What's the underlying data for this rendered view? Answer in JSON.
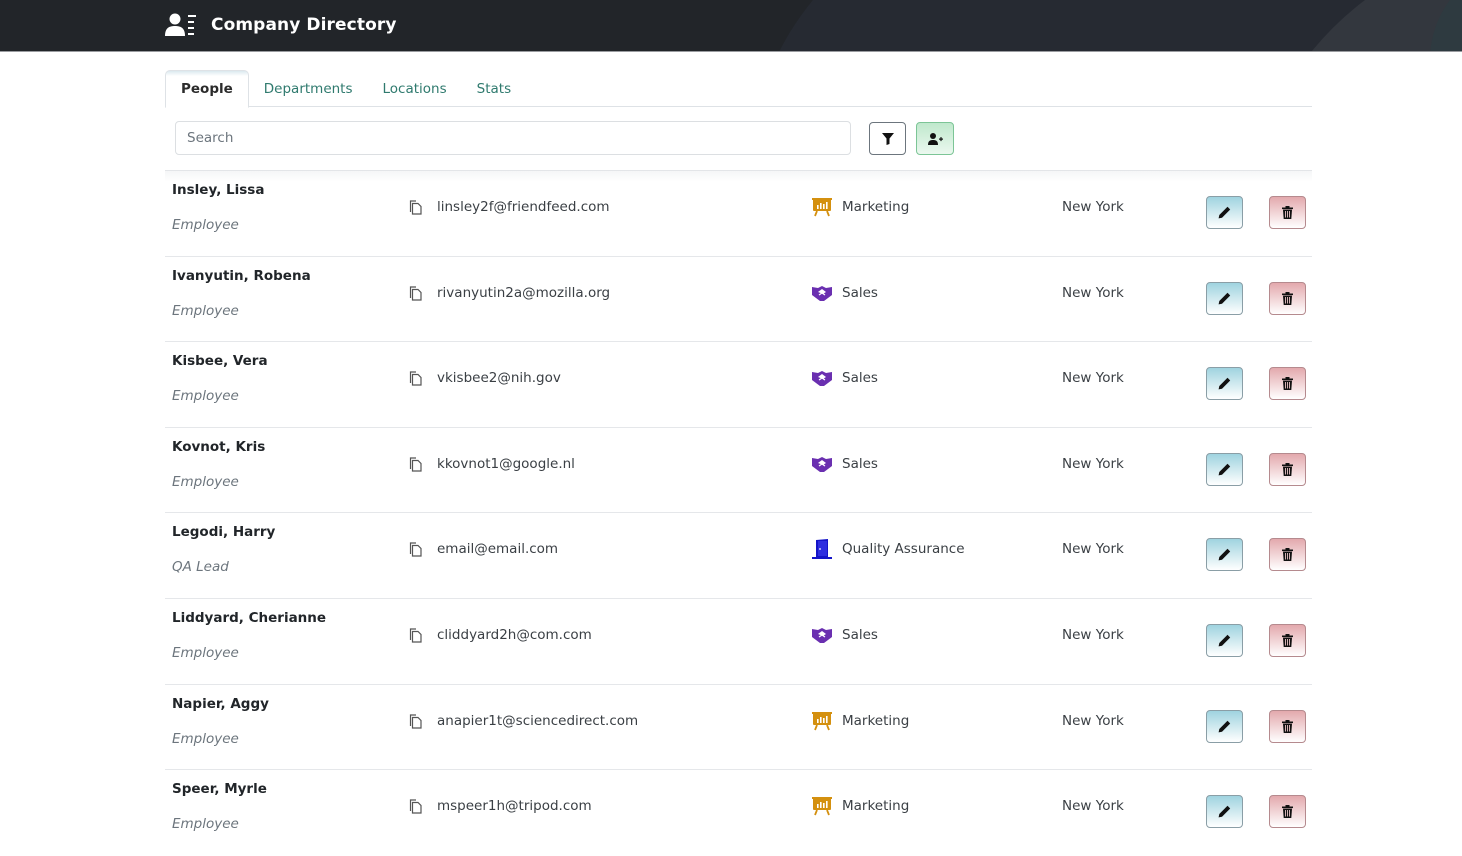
{
  "header": {
    "title": "Company Directory",
    "logo_icon": "address-book-user-icon"
  },
  "tabs": [
    {
      "label": "People",
      "active": true
    },
    {
      "label": "Departments",
      "active": false
    },
    {
      "label": "Locations",
      "active": false
    },
    {
      "label": "Stats",
      "active": false
    }
  ],
  "toolbar": {
    "search_placeholder": "Search",
    "search_value": "",
    "filter_icon": "filter-icon",
    "add_icon": "user-plus-icon"
  },
  "colors": {
    "header_bg": "#222529",
    "tab_link": "#2f7a6e",
    "marketing_icon": "#d4900f",
    "sales_icon": "#6a2fb0",
    "qa_icon": "#1414c8",
    "edit_button": "#9fd3df",
    "delete_button": "#e3a9ad",
    "add_button": "#bfe8cc"
  },
  "people": [
    {
      "name": "Insley, Lissa",
      "role": "Employee",
      "email": "linsley2f@friendfeed.com",
      "department": "Marketing",
      "dept_icon": "presentation-chart-icon",
      "location": "New York"
    },
    {
      "name": "Ivanyutin, Robena",
      "role": "Employee",
      "email": "rivanyutin2a@mozilla.org",
      "department": "Sales",
      "dept_icon": "handshake-icon",
      "location": "New York"
    },
    {
      "name": "Kisbee, Vera",
      "role": "Employee",
      "email": "vkisbee2@nih.gov",
      "department": "Sales",
      "dept_icon": "handshake-icon",
      "location": "New York"
    },
    {
      "name": "Kovnot, Kris",
      "role": "Employee",
      "email": "kkovnot1@google.nl",
      "department": "Sales",
      "dept_icon": "handshake-icon",
      "location": "New York"
    },
    {
      "name": "Legodi, Harry",
      "role": "QA Lead",
      "email": "email@email.com",
      "department": "Quality Assurance",
      "dept_icon": "door-icon",
      "location": "New York"
    },
    {
      "name": "Liddyard, Cherianne",
      "role": "Employee",
      "email": "cliddyard2h@com.com",
      "department": "Sales",
      "dept_icon": "handshake-icon",
      "location": "New York"
    },
    {
      "name": "Napier, Aggy",
      "role": "Employee",
      "email": "anapier1t@sciencedirect.com",
      "department": "Marketing",
      "dept_icon": "presentation-chart-icon",
      "location": "New York"
    },
    {
      "name": "Speer, Myrle",
      "role": "Employee",
      "email": "mspeer1h@tripod.com",
      "department": "Marketing",
      "dept_icon": "presentation-chart-icon",
      "location": "New York"
    }
  ]
}
